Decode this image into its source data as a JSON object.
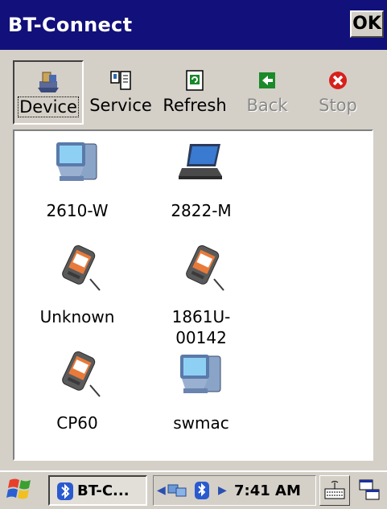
{
  "window": {
    "title": "BT-Connect",
    "ok_label": "OK"
  },
  "toolbar": [
    {
      "label": "Device",
      "icon": "device-icon",
      "state": "pressed"
    },
    {
      "label": "Service",
      "icon": "service-icon",
      "state": "normal"
    },
    {
      "label": "Refresh",
      "icon": "refresh-icon",
      "state": "normal"
    },
    {
      "label": "Back",
      "icon": "back-arrow-icon",
      "state": "disabled"
    },
    {
      "label": "Stop",
      "icon": "stop-icon",
      "state": "disabled"
    }
  ],
  "devices": [
    {
      "name": "2610-W",
      "icon": "desktop-computer-icon"
    },
    {
      "name": "2822-M",
      "icon": "laptop-icon"
    },
    {
      "name": "Unknown",
      "icon": "pda-icon"
    },
    {
      "name": "1861U-\n00142",
      "icon": "pda-icon"
    },
    {
      "name": "CP60",
      "icon": "pda-icon"
    },
    {
      "name": "swmac",
      "icon": "desktop-computer-icon"
    }
  ],
  "taskbar": {
    "app_label": "BT-C...",
    "time": "7:41 AM"
  }
}
